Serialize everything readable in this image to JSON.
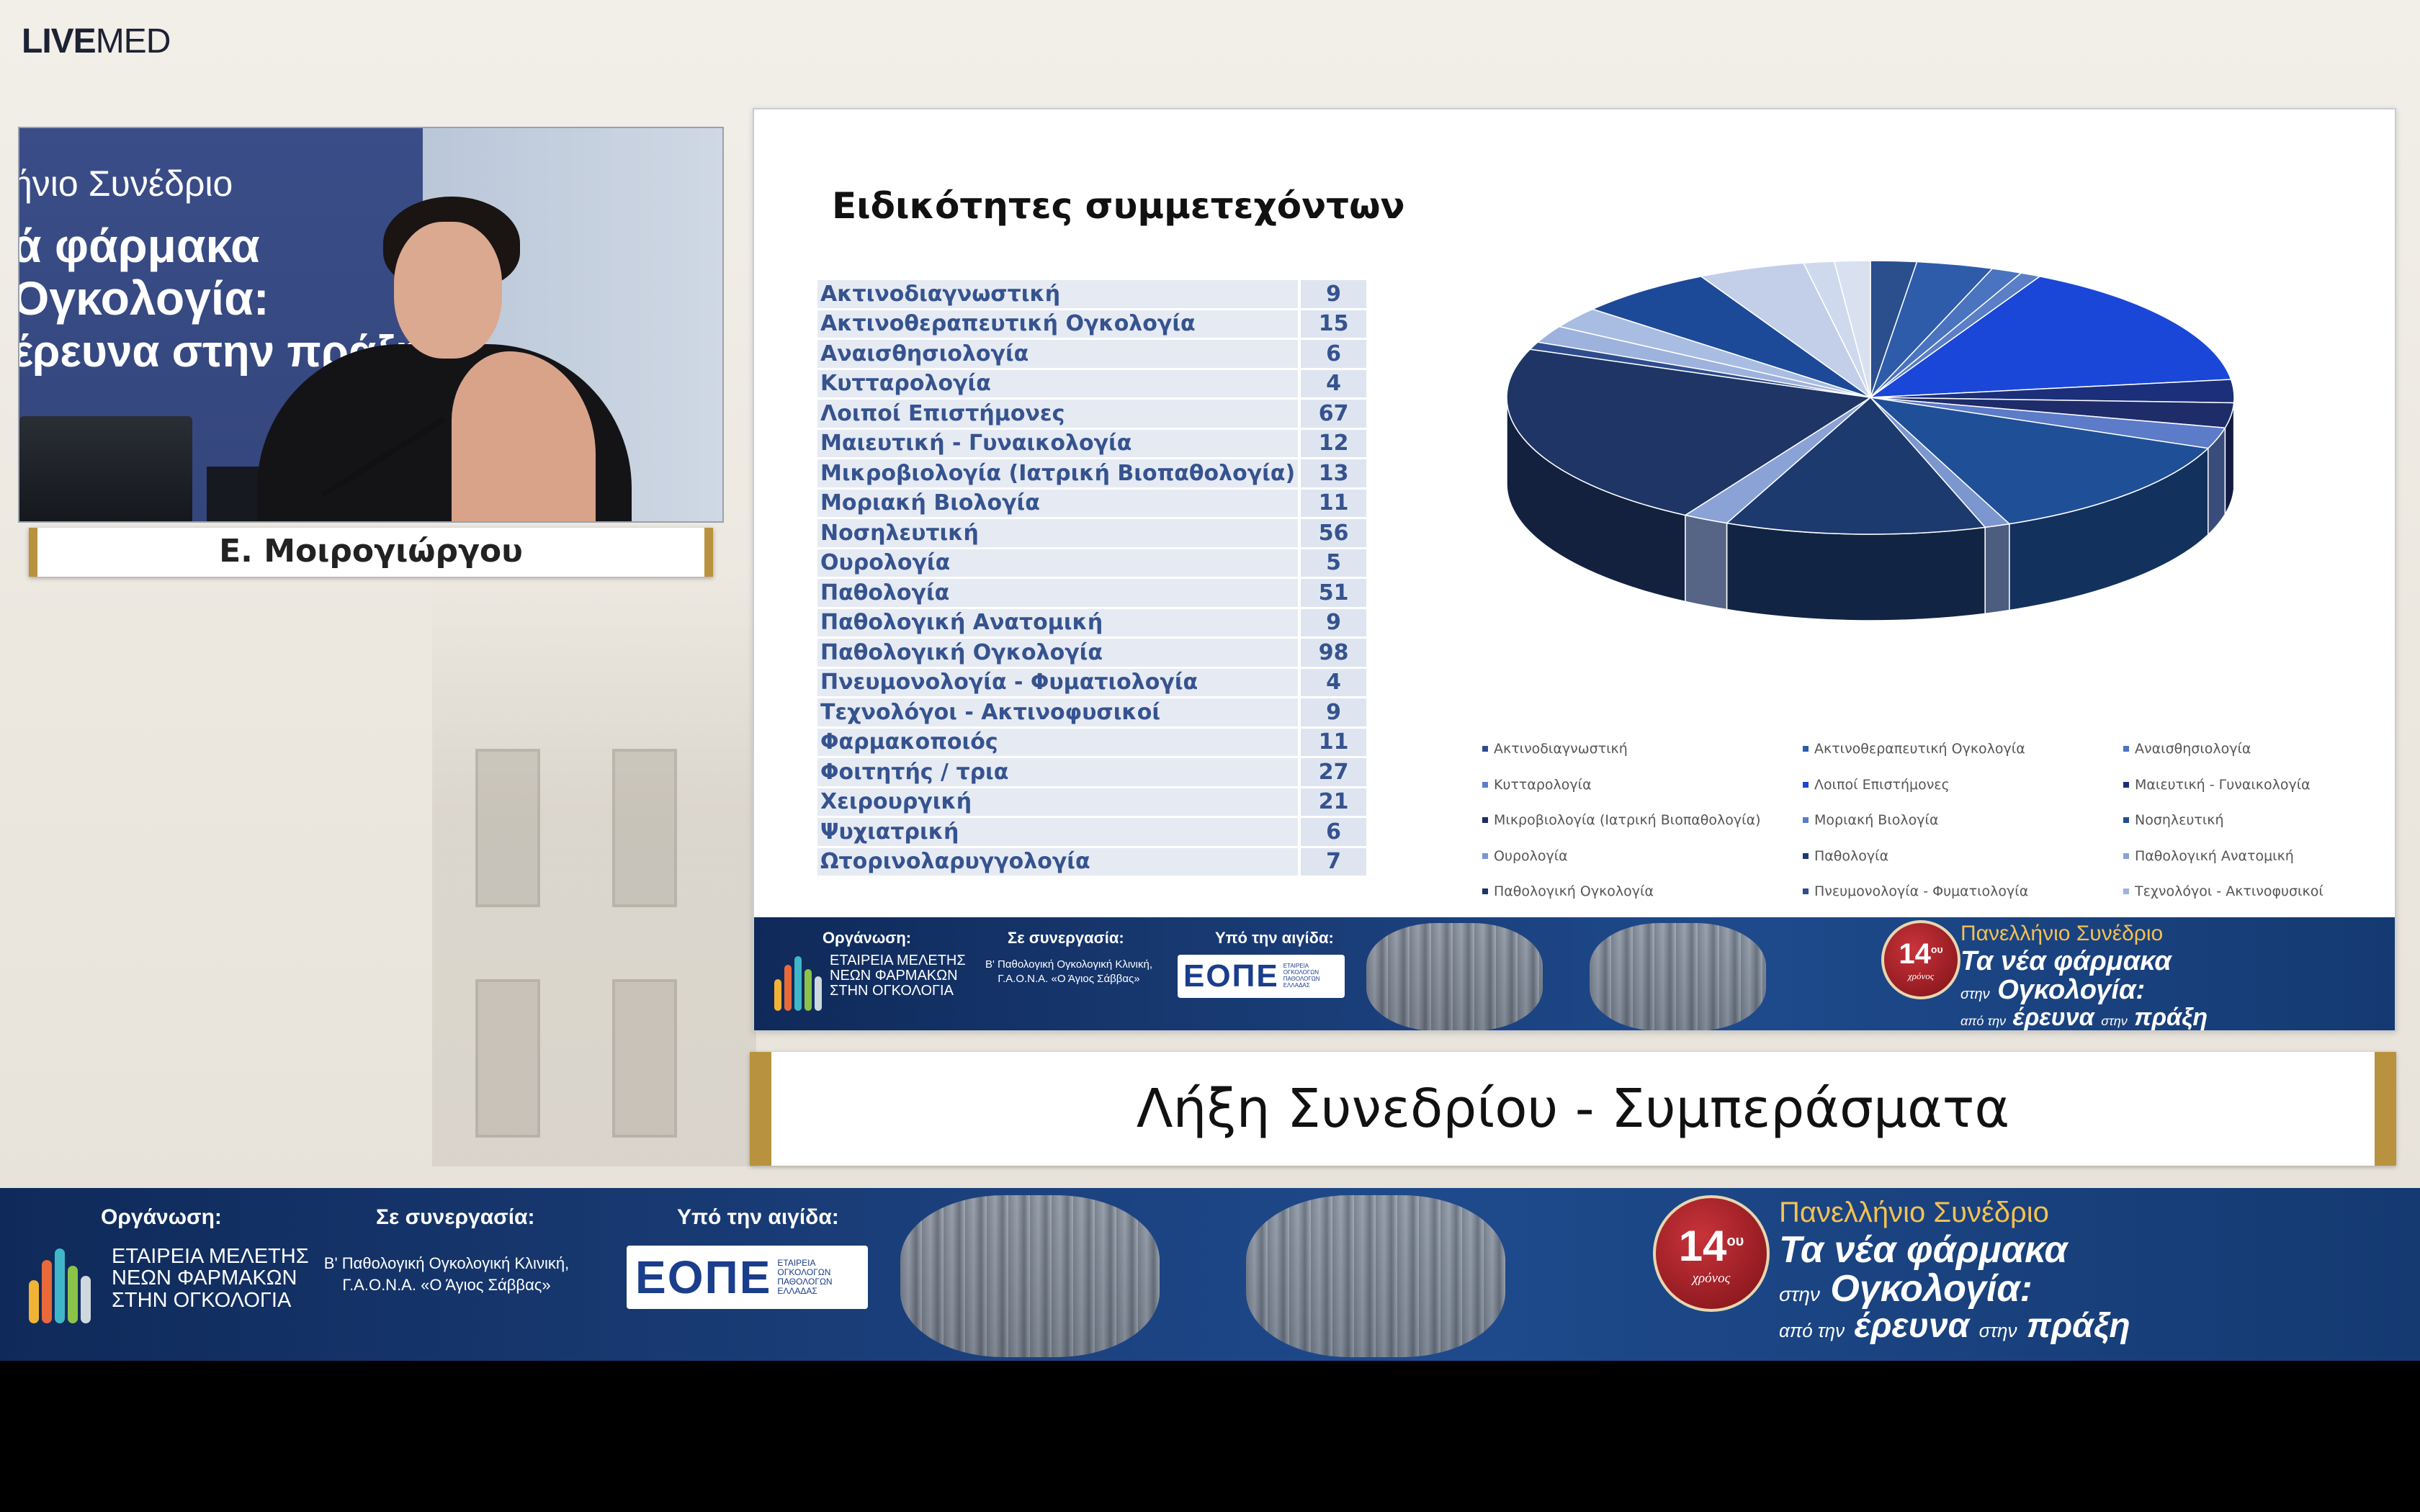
{
  "app": {
    "logo_bold": "LIVE",
    "logo_rest": "MED"
  },
  "video": {
    "backdrop_lines": [
      "ήνιο Συνέδριο",
      "ά φάρμακα",
      "Ογκολογία:",
      "έρευνα στην πράξη"
    ],
    "speaker_name": "Ε. Μοιρογιώργου"
  },
  "slide": {
    "title": "Ειδικότητες συμμετεχόντων",
    "table": [
      {
        "label": "Ακτινοδιαγνωστική",
        "value": "9"
      },
      {
        "label": "Ακτινοθεραπευτική Ογκολογία",
        "value": "15"
      },
      {
        "label": "Αναισθησιολογία",
        "value": "6"
      },
      {
        "label": "Κυτταρολογία",
        "value": "4"
      },
      {
        "label": "Λοιποί Επιστήμονες",
        "value": "67"
      },
      {
        "label": "Μαιευτική - Γυναικολογία",
        "value": "12"
      },
      {
        "label": "Μικροβιολογία (Ιατρική Βιοπαθολογία)",
        "value": "13"
      },
      {
        "label": "Μοριακή Βιολογία",
        "value": "11"
      },
      {
        "label": "Νοσηλευτική",
        "value": "56"
      },
      {
        "label": "Ουρολογία",
        "value": "5"
      },
      {
        "label": "Παθολογία",
        "value": "51"
      },
      {
        "label": "Παθολογική Ανατομική",
        "value": "9"
      },
      {
        "label": "Παθολογική Ογκολογία",
        "value": "98"
      },
      {
        "label": "Πνευμονολογία - Φυματιολογία",
        "value": "4"
      },
      {
        "label": "Τεχνολόγοι - Ακτινοφυσικοί",
        "value": "9"
      },
      {
        "label": "Φαρμακοποιός",
        "value": "11"
      },
      {
        "label": "Φοιτητής / τρια",
        "value": "27"
      },
      {
        "label": "Χειρουργική",
        "value": "21"
      },
      {
        "label": "Ψυχιατρική",
        "value": "6"
      },
      {
        "label": "Ωτορινολαρυγγολογία",
        "value": "7"
      }
    ]
  },
  "chart_data": {
    "type": "pie",
    "title": "Ειδικότητες συμμετεχόντων",
    "three_d": true,
    "categories": [
      "Ακτινοδιαγνωστική",
      "Ακτινοθεραπευτική Ογκολογία",
      "Αναισθησιολογία",
      "Κυτταρολογία",
      "Λοιποί Επιστήμονες",
      "Μαιευτική - Γυναικολογία",
      "Μικροβιολογία (Ιατρική Βιοπαθολογία)",
      "Μοριακή Βιολογία",
      "Νοσηλευτική",
      "Ουρολογία",
      "Παθολογία",
      "Παθολογική Ανατομική",
      "Παθολογική Ογκολογία",
      "Πνευμονολογία - Φυματιολογία",
      "Τεχνολόγοι - Ακτινοφυσικοί",
      "Φαρμακοποιός",
      "Φοιτητής / τρια",
      "Χειρουργική",
      "Ψυχιατρική",
      "Ωτορινολαρυγγολογία"
    ],
    "values": [
      9,
      15,
      6,
      4,
      67,
      12,
      13,
      11,
      56,
      5,
      51,
      9,
      98,
      4,
      9,
      11,
      27,
      21,
      6,
      7
    ],
    "colors": [
      "#2b4e8c",
      "#2e5cab",
      "#4a74c0",
      "#5a7fc6",
      "#1a47d8",
      "#1b2f7a",
      "#1f2c6a",
      "#5c7bc8",
      "#1f4f96",
      "#7c96cf",
      "#1d3a6e",
      "#8aa2d6",
      "#1e3566",
      "#2f4d8e",
      "#9db2dd",
      "#a9bde3",
      "#1d4a98",
      "#c3cfe9",
      "#cfd9ee",
      "#d9e1f1"
    ],
    "legend_position": "bottom",
    "legend_columns": 3
  },
  "slide_banner": {
    "org_label": "Οργάνωση:",
    "org_name": [
      "ΕΤΑΙΡΕΙΑ ΜΕΛΕΤΗΣ",
      "ΝΕΩΝ ΦΑΡΜΑΚΩΝ",
      "ΣΤΗΝ ΟΓΚΟΛΟΓΙΑ"
    ],
    "coop_label": "Σε συνεργασία:",
    "coop_text": [
      "Β' Παθολογική Ογκολογική Κλινική,",
      "Γ.Α.Ο.Ν.Α. «Ο Άγιος Σάββας»"
    ],
    "aegis_label": "Υπό την αιγίδα:",
    "eope": "ΕΟΠΕ",
    "eope_small": [
      "ΕΤΑΙΡΕΙΑ",
      "ΟΓΚΟΛΟΓΩΝ",
      "ΠΑΘΟΛΟΓΩΝ",
      "ΕΛΛΑΔΑΣ"
    ],
    "badge_num": "14",
    "badge_sup": "ου",
    "badge_sub": "χρόνος",
    "conf_l1": "Πανελλήνιο Συνέδριο",
    "conf_l2": "Τα νέα φάρμακα",
    "conf_l3a": "στην",
    "conf_l3b": "Ογκολογία:",
    "conf_l4a": "από την",
    "conf_l4b": "έρευνα",
    "conf_l4c": "στην",
    "conf_l4d": "πράξη"
  },
  "session": {
    "title": "Λήξη Συνεδρίου - Συμπεράσματα"
  },
  "bottom_banner": {
    "org_label": "Οργάνωση:",
    "org_name": [
      "ΕΤΑΙΡΕΙΑ ΜΕΛΕΤΗΣ",
      "ΝΕΩΝ ΦΑΡΜΑΚΩΝ",
      "ΣΤΗΝ ΟΓΚΟΛΟΓΙΑ"
    ],
    "coop_label": "Σε συνεργασία:",
    "coop_text": [
      "Β' Παθολογική Ογκολογική Κλινική,",
      "Γ.Α.Ο.Ν.Α. «Ο Άγιος Σάββας»"
    ],
    "aegis_label": "Υπό την αιγίδα:",
    "eope": "ΕΟΠΕ",
    "eope_small": [
      "ΕΤΑΙΡΕΙΑ",
      "ΟΓΚΟΛΟΓΩΝ",
      "ΠΑΘΟΛΟΓΩΝ",
      "ΕΛΛΑΔΑΣ"
    ],
    "badge_num": "14",
    "badge_sup": "ου",
    "badge_sub": "χρόνος",
    "conf_l1": "Πανελλήνιο Συνέδριο",
    "conf_l2": "Τα νέα φάρμακα",
    "conf_l3a": "στην",
    "conf_l3b": "Ογκολογία:",
    "conf_l4a": "από την",
    "conf_l4b": "έρευνα",
    "conf_l4c": "στην",
    "conf_l4d": "πράξη"
  }
}
